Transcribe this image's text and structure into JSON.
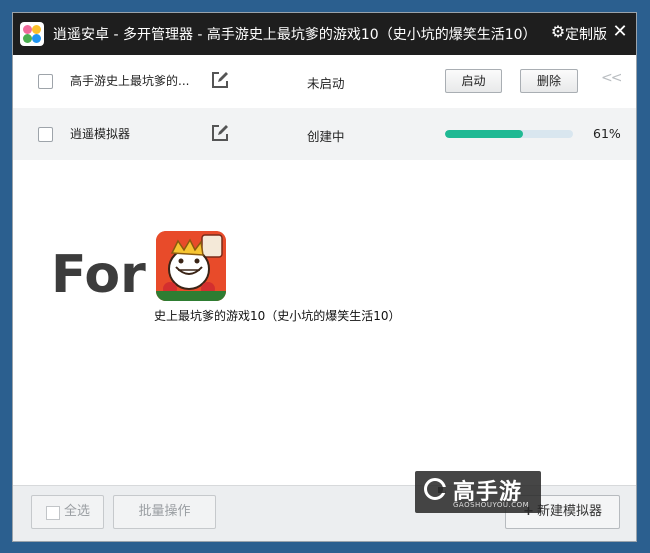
{
  "window": {
    "title": "逍遥安卓 - 多开管理器 - 高手游史上最坑爹的游戏10（史小坑的爆笑生活10）",
    "custom_label": "定制版",
    "gear_icon": "gear-icon",
    "close_icon": "close-icon"
  },
  "instances": [
    {
      "name": "高手游史上最坑爹的...",
      "status": "未启动",
      "start_label": "启动",
      "delete_label": "删除",
      "collapse_glyph": "<<"
    },
    {
      "name": "逍遥模拟器",
      "status": "创建中",
      "progress": 0.61,
      "progress_text": "61%"
    }
  ],
  "promo": {
    "for_text": "For",
    "game_caption": "史上最坑爹的游戏10（史小坑的爆笑生活10）"
  },
  "footer": {
    "select_all": "全选",
    "batch": "批量操作",
    "new_emulator": "新建模拟器"
  },
  "watermark": {
    "brand": "高手游",
    "domain": "GAOSHOUYOU.COM"
  },
  "colors": {
    "titlebar": "#1e1e1e",
    "progress": "#1fb993",
    "background": "#2b5f8f"
  }
}
